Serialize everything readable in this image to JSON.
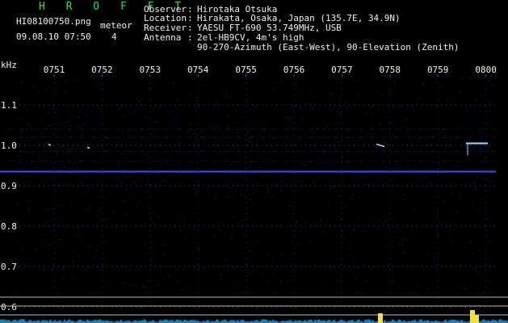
{
  "app": {
    "name": "H R O F F T",
    "filename": "HI08100750.png",
    "datetime": "09.08.10 07:50",
    "counter_label": "meteor",
    "counter_value": "4"
  },
  "station": {
    "rows": [
      {
        "label": "Observer",
        "value": "Hirotaka Otsuka"
      },
      {
        "label": "Location",
        "value": "Hirakata, Osaka, Japan (135.7E, 34.9N)"
      },
      {
        "label": "Receiver",
        "value": "YAESU FT-690 53.749MHz, USB"
      },
      {
        "label": "Antenna ",
        "value": "2el-HB9CV, 4m's high"
      }
    ],
    "antenna_line2": "90-270-Azimuth (East-West), 90-Elevation (Zenith)"
  },
  "spectrogram": {
    "unit": "kHz",
    "time_labels": [
      "0751",
      "0752",
      "0753",
      "0754",
      "0755",
      "0756",
      "0757",
      "0758",
      "0759",
      "0800"
    ],
    "freq_labels": [
      "1.1",
      "1.0",
      "0.9",
      "0.8",
      "0.7",
      "0.6"
    ],
    "freq_values": [
      1.1,
      1.0,
      0.9,
      0.8,
      0.7,
      0.6
    ],
    "colors": {
      "background": "#000000",
      "grid": "#1e5ad8",
      "noise": "#1838b8",
      "carrier": "#3050ff",
      "echo": "#8fe0ff",
      "audio_trace": "#20a0e0",
      "audio_peak": "#f0e040"
    },
    "meteor_echo_times": [
      "0751",
      "0752",
      "0757",
      "0800"
    ]
  }
}
